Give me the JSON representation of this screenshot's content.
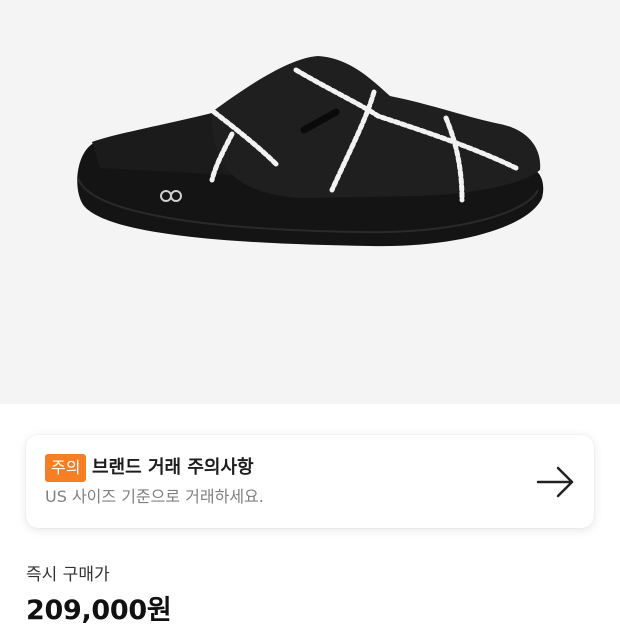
{
  "product": {
    "image_name": "black-slide-clog-with-white-chain-print",
    "logo_mark": "oo"
  },
  "notice": {
    "badge": "주의",
    "title": "브랜드 거래 주의사항",
    "subtitle": "US 사이즈 기준으로 거래하세요.",
    "badge_color": "#f57f22",
    "action_icon": "arrow-right-icon"
  },
  "price": {
    "label": "즉시 구매가",
    "value": "209,000원"
  }
}
